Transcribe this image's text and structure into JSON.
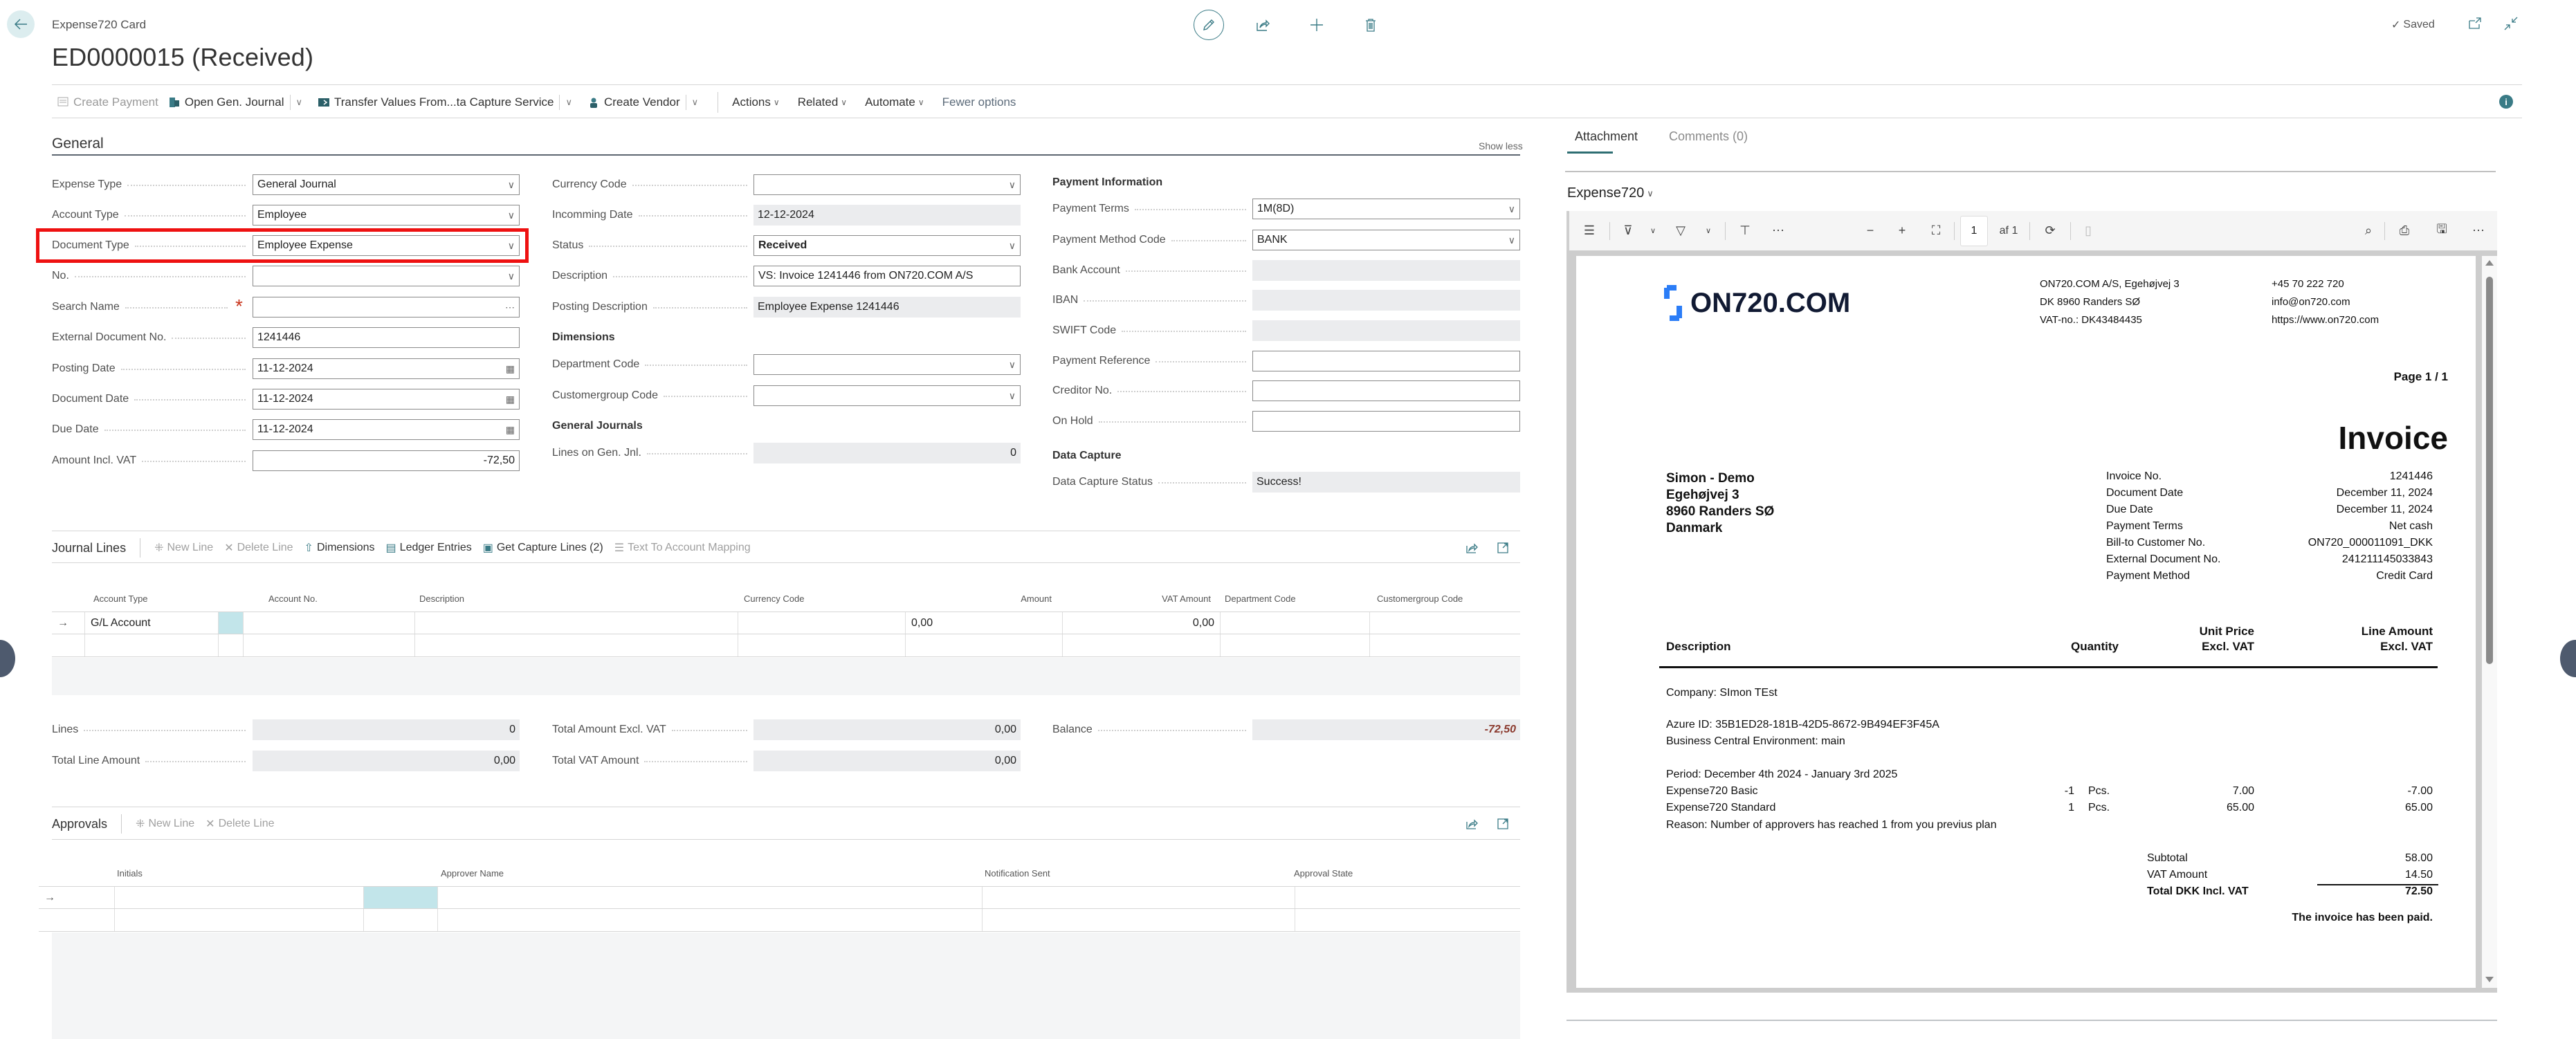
{
  "header": {
    "breadcrumb": "Expense720 Card",
    "title": "ED0000015 (Received)",
    "saved_label": "Saved",
    "icons": [
      "edit-icon",
      "share-icon",
      "add-icon",
      "delete-icon"
    ]
  },
  "actionbar": {
    "create_payment": "Create Payment",
    "open_gen_journal": "Open Gen. Journal",
    "transfer_values": "Transfer Values From...ta Capture Service",
    "create_vendor": "Create Vendor",
    "actions": "Actions",
    "related": "Related",
    "automate": "Automate",
    "fewer_options": "Fewer options"
  },
  "general": {
    "title": "General",
    "show_less": "Show less",
    "col1": [
      {
        "label": "Expense Type",
        "value": "General Journal",
        "kind": "select"
      },
      {
        "label": "Account Type",
        "value": "Employee",
        "kind": "select"
      },
      {
        "label": "Document Type",
        "value": "Employee Expense",
        "kind": "select"
      },
      {
        "label": "No.",
        "value": "",
        "kind": "select"
      },
      {
        "label": "Search Name",
        "value": "",
        "kind": "lookup"
      },
      {
        "label": "External Document No.",
        "value": "1241446",
        "kind": "text"
      },
      {
        "label": "Posting Date",
        "value": "11-12-2024",
        "kind": "date"
      },
      {
        "label": "Document Date",
        "value": "11-12-2024",
        "kind": "date"
      },
      {
        "label": "Due Date",
        "value": "11-12-2024",
        "kind": "date"
      },
      {
        "label": "Amount Incl. VAT",
        "value": "-72,50",
        "kind": "number"
      }
    ],
    "col2": {
      "currency_code": {
        "label": "Currency Code",
        "value": ""
      },
      "incoming_date": {
        "label": "Incomming Date",
        "value": "12-12-2024"
      },
      "status": {
        "label": "Status",
        "value": "Received"
      },
      "description": {
        "label": "Description",
        "value": "VS: Invoice 1241446 from ON720.COM A/S"
      },
      "posting_description": {
        "label": "Posting Description",
        "value": "Employee Expense 1241446"
      },
      "dimensions_heading": "Dimensions",
      "department_code": {
        "label": "Department Code",
        "value": ""
      },
      "customergroup_code": {
        "label": "Customergroup Code",
        "value": ""
      },
      "general_journals_heading": "General Journals",
      "lines_on_gen_jnl": {
        "label": "Lines on Gen. Jnl.",
        "value": "0"
      }
    },
    "col3": {
      "payment_info_heading": "Payment Information",
      "payment_terms": {
        "label": "Payment Terms",
        "value": "1M(8D)"
      },
      "payment_method_code": {
        "label": "Payment Method Code",
        "value": "BANK"
      },
      "bank_account": {
        "label": "Bank Account",
        "value": ""
      },
      "iban": {
        "label": "IBAN",
        "value": ""
      },
      "swift_code": {
        "label": "SWIFT Code",
        "value": ""
      },
      "payment_reference": {
        "label": "Payment Reference",
        "value": ""
      },
      "creditor_no": {
        "label": "Creditor No.",
        "value": ""
      },
      "on_hold": {
        "label": "On Hold",
        "value": ""
      },
      "data_capture_heading": "Data Capture",
      "data_capture_status": {
        "label": "Data Capture Status",
        "value": "Success!"
      }
    }
  },
  "journal_lines": {
    "title": "Journal Lines",
    "actions": {
      "new_line": "New Line",
      "delete_line": "Delete Line",
      "dimensions": "Dimensions",
      "ledger_entries": "Ledger Entries",
      "get_capture_lines": "Get Capture Lines (2)",
      "text_to_account_mapping": "Text To Account Mapping"
    },
    "columns": [
      "Account Type",
      "Account No.",
      "Description",
      "Currency Code",
      "Amount",
      "VAT Amount",
      "Department Code",
      "Customergroup Code"
    ],
    "rows": [
      {
        "account_type": "G/L Account",
        "account_no": "",
        "description": "",
        "currency_code": "",
        "amount": "0,00",
        "vat_amount": "0,00",
        "department_code": "",
        "customergroup_code": ""
      }
    ]
  },
  "totals": {
    "lines": {
      "label": "Lines",
      "value": "0"
    },
    "total_line_amount": {
      "label": "Total Line Amount",
      "value": "0,00"
    },
    "total_amount_excl_vat": {
      "label": "Total Amount Excl. VAT",
      "value": "0,00"
    },
    "total_vat_amount": {
      "label": "Total VAT Amount",
      "value": "0,00"
    },
    "balance": {
      "label": "Balance",
      "value": "-72,50"
    }
  },
  "approvals": {
    "title": "Approvals",
    "actions": {
      "new_line": "New Line",
      "delete_line": "Delete Line"
    },
    "columns": [
      "Initials",
      "Approver Name",
      "Notification Sent",
      "Approval State"
    ]
  },
  "factbox": {
    "tabs": [
      {
        "label": "Attachment",
        "active": true
      },
      {
        "label": "Comments (0)",
        "active": false
      }
    ],
    "attachment_name": "Expense720",
    "viewer": {
      "page_input": "1",
      "page_of": "af 1"
    },
    "invoice": {
      "logo_text": "ON720.COM",
      "sender_address": [
        "ON720.COM A/S, Egehøjvej 3",
        "DK 8960 Randers SØ",
        "VAT-no.: DK43484435"
      ],
      "sender_contact": [
        "+45 70 222 720",
        "info@on720.com",
        "https://www.on720.com"
      ],
      "page_label": "Page 1 / 1",
      "title": "Invoice",
      "bill_to": [
        "Simon - Demo",
        "Egehøjvej 3",
        "8960 Randers SØ",
        "Danmark"
      ],
      "meta": [
        {
          "label": "Invoice No.",
          "value": "1241446"
        },
        {
          "label": "Document Date",
          "value": "December 11, 2024"
        },
        {
          "label": "Due Date",
          "value": "December 11, 2024"
        },
        {
          "label": "Payment Terms",
          "value": "Net cash"
        },
        {
          "label": "Bill-to Customer No.",
          "value": "ON720_000011091_DKK"
        },
        {
          "label": "External Document No.",
          "value": "241211145033843"
        },
        {
          "label": "Payment Method",
          "value": "Credit Card"
        }
      ],
      "table_headers": {
        "description": "Description",
        "quantity": "Quantity",
        "unit_price_1": "Unit Price",
        "unit_price_2": "Excl. VAT",
        "line_amount_1": "Line Amount",
        "line_amount_2": "Excl. VAT"
      },
      "company_line": "Company: SImon TEst",
      "azure_id": "Azure ID: 35B1ED28-181B-42D5-8672-9B494EF3F45A",
      "bc_env": "Business Central Environment: main",
      "period": "Period: December 4th 2024 - January 3rd 2025",
      "lines": [
        {
          "description": "Expense720 Basic",
          "qty": "-1",
          "unit": "Pcs.",
          "unit_price": "7.00",
          "amount": "-7.00"
        },
        {
          "description": "Expense720 Standard",
          "qty": "1",
          "unit": "Pcs.",
          "unit_price": "65.00",
          "amount": "65.00"
        }
      ],
      "reason": "Reason: Number of approvers has reached 1 from you previus plan",
      "subtotal": {
        "label": "Subtotal",
        "value": "58.00"
      },
      "vat": {
        "label": "VAT Amount",
        "value": "14.50"
      },
      "total": {
        "label": "Total DKK Incl. VAT",
        "value": "72.50"
      },
      "paid_note": "The invoice has been paid."
    }
  },
  "colors": {
    "accent": "#3a7b86",
    "highlight": "#ee1111",
    "negative": "#8b3a2e",
    "selection": "#c2e5ea"
  }
}
